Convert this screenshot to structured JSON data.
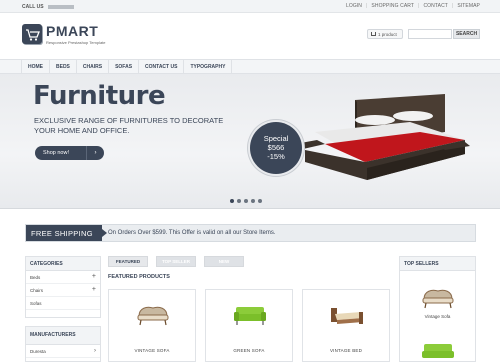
{
  "topbar": {
    "call_label": "CALL US",
    "links": [
      "LOGIN",
      "SHOPPING CART",
      "CONTACT",
      "SITEMAP"
    ]
  },
  "header": {
    "logo": "PMART",
    "tagline": "Responsive Prestashop Template",
    "cart": "1 product",
    "search_button": "SEARCH",
    "search_placeholder": ""
  },
  "nav": [
    "HOME",
    "BEDS",
    "CHAIRS",
    "SOFAS",
    "CONTACT US",
    "TYPOGRAPHY"
  ],
  "hero": {
    "title": "Furniture",
    "subtitle": "EXCLUSIVE RANGE OF FURNITURES TO DECORATE YOUR HOME AND OFFICE.",
    "button": "Shop now!",
    "button_arrow": "›",
    "special": {
      "line1": "Special",
      "line2": "$566",
      "line3": "-15%"
    },
    "dots": 5,
    "active_dot": 0
  },
  "shipping": {
    "label": "FREE SHIPPING",
    "text": "On Orders Over $599. This Offer is valid on all our Store Items."
  },
  "categories": {
    "title": "CATEGORIES",
    "items": [
      {
        "label": "Beds",
        "plus": "+"
      },
      {
        "label": "Chairs",
        "plus": "+"
      },
      {
        "label": "Sofas",
        "plus": ""
      }
    ]
  },
  "manufacturers": {
    "title": "MANUFACTURERS",
    "items": [
      {
        "label": "Duresta",
        "arrow": "›"
      }
    ]
  },
  "tabs": [
    "FEATURED",
    "TOP SELLER",
    "NEW"
  ],
  "featured_title": "FEATURED PRODUCTS",
  "products": [
    {
      "name": "VINTAGE SOFA",
      "color": "#8a6a4a"
    },
    {
      "name": "GREEN SOFA",
      "color": "#7bbf2a"
    },
    {
      "name": "VINTAGE BED",
      "color": "#a0704a"
    }
  ],
  "top_sellers": {
    "title": "TOP SELLERS",
    "items": [
      "Vintage Sofa"
    ]
  },
  "colors": {
    "primary": "#3b4658",
    "special_bg": "#3b4658"
  }
}
